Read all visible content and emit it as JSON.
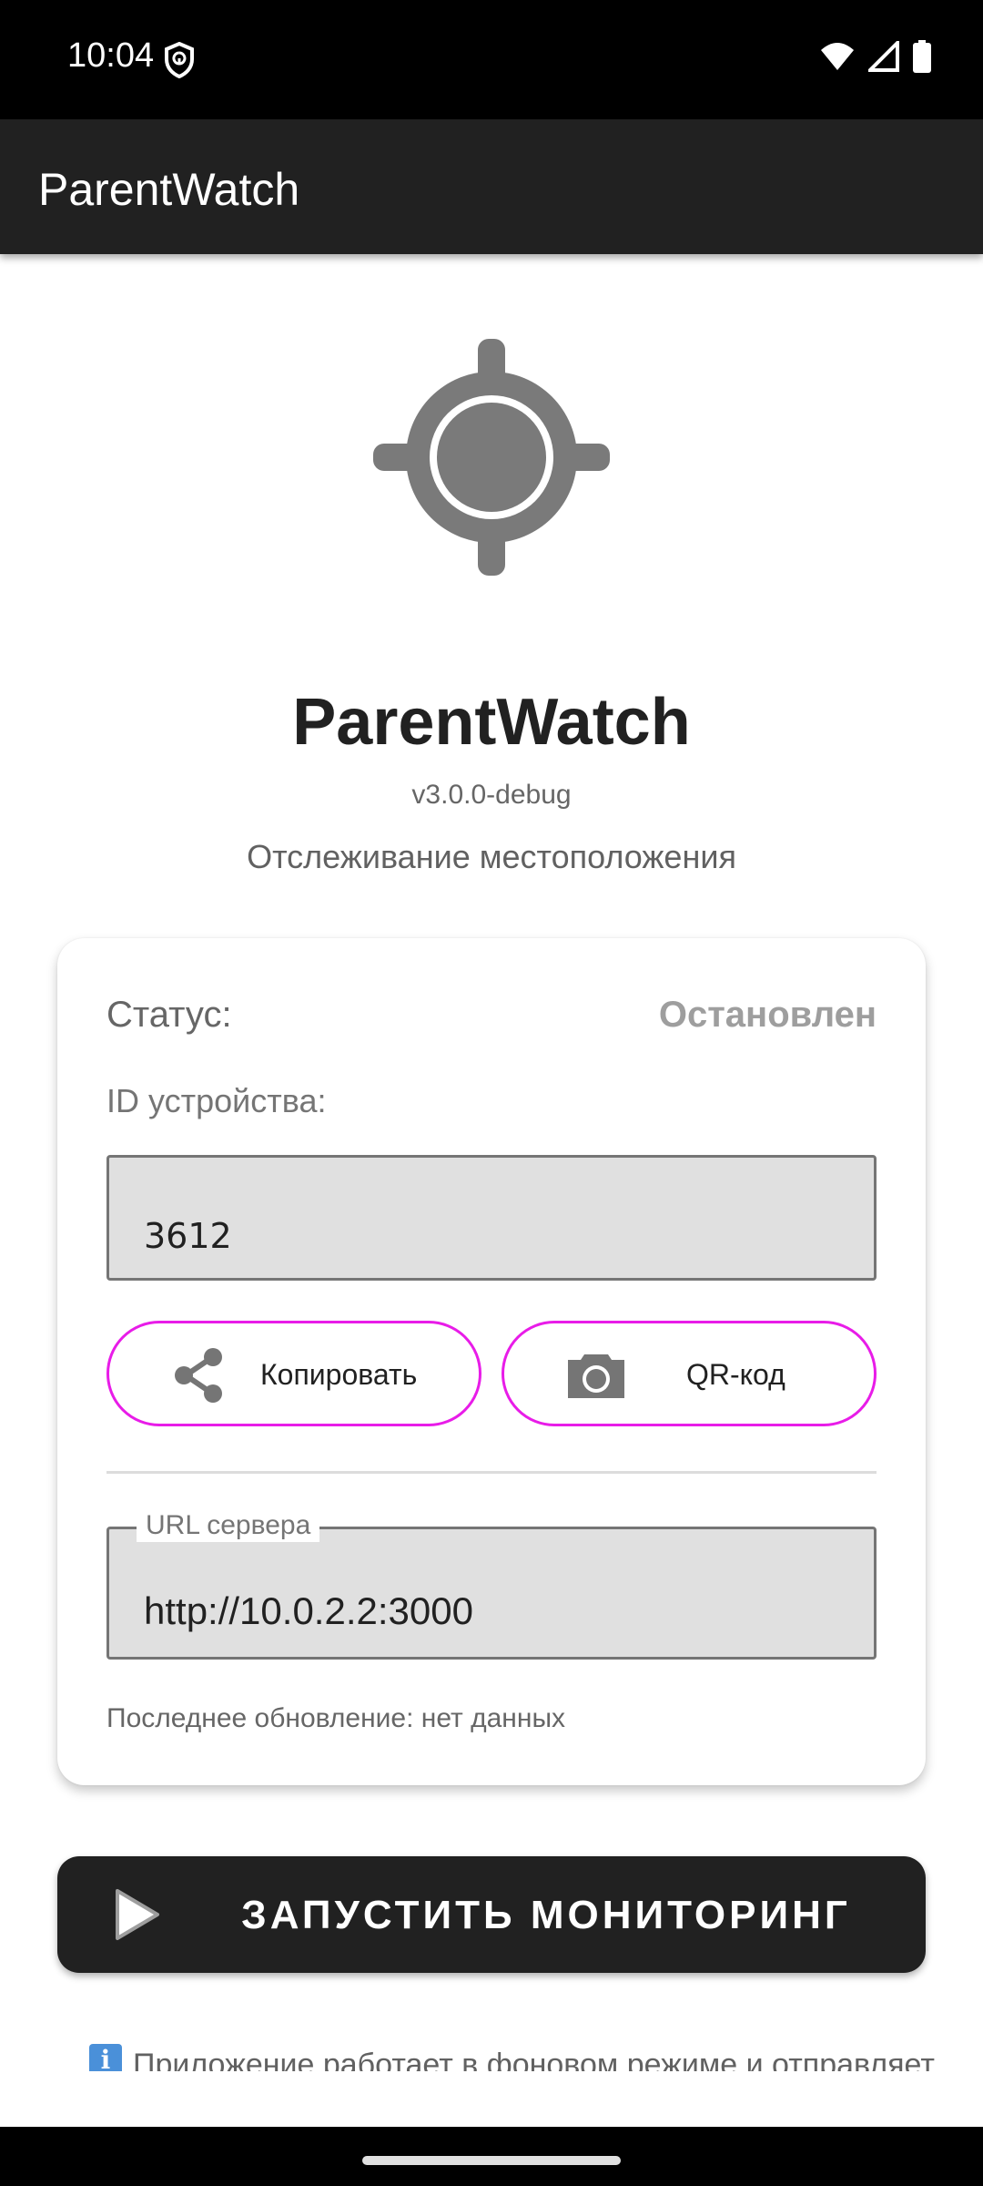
{
  "status_bar": {
    "time": "10:04"
  },
  "app_bar": {
    "title": "ParentWatch"
  },
  "header": {
    "app_name": "ParentWatch",
    "version": "v3.0.0-debug",
    "tagline": "Отслеживание местоположения"
  },
  "card": {
    "status_label": "Статус:",
    "status_value": "Остановлен",
    "device_id_label": "ID устройства:",
    "device_id_value": "3612",
    "copy_button_label": "Копировать",
    "qr_button_label": "QR-код",
    "server_url_label": "URL сервера",
    "server_url_value": "http://10.0.2.2:3000",
    "last_update": "Последнее обновление: нет данных"
  },
  "start_button": {
    "label": "ЗАПУСТИТЬ МОНИТОРИНГ"
  },
  "info": {
    "text": "Приложение работает в фоновом режиме и отправляет"
  },
  "icons": {
    "logo": "crosshair-icon",
    "copy": "share-icon",
    "qr": "camera-icon",
    "start": "play-icon",
    "info": "info-icon"
  },
  "colors": {
    "app_bar": "#212121",
    "button_outline": "#e81ce8",
    "start_button": "#212121",
    "status_stopped": "#9e9e9e"
  }
}
